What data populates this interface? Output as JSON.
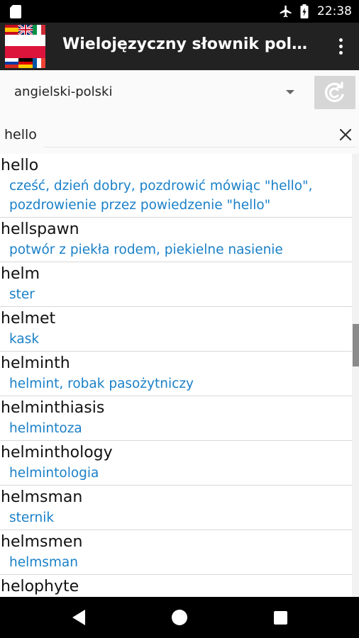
{
  "status_bar": {
    "time": "22:38",
    "icons": [
      "sim-card-icon",
      "airplane-mode-icon",
      "battery-icon"
    ]
  },
  "toolbar": {
    "title": "Wielojęzyczny słownik polski…",
    "logo_icon": "flags-logo-icon",
    "menu_icon": "overflow-menu-icon"
  },
  "language": {
    "selected": "angielski-polski",
    "swap_icon": "swap-languages-icon"
  },
  "search": {
    "value": "hello",
    "clear_icon": "close-icon"
  },
  "results": [
    {
      "word": "hello",
      "translation": "cześć, dzień dobry, pozdrowić mówiąc \"hello\", pozdrowienie przez powiedzenie \"hello\""
    },
    {
      "word": "hellspawn",
      "translation": "potwór z piekła rodem, piekielne nasienie"
    },
    {
      "word": "helm",
      "translation": "ster"
    },
    {
      "word": "helmet",
      "translation": "kask"
    },
    {
      "word": "helminth",
      "translation": "helmint, robak pasożytniczy"
    },
    {
      "word": "helminthiasis",
      "translation": "helmintoza"
    },
    {
      "word": "helminthology",
      "translation": "helmintologia"
    },
    {
      "word": "helmsman",
      "translation": "sternik"
    },
    {
      "word": "helmsmen",
      "translation": "helmsman"
    },
    {
      "word": "helophyte",
      "translation": ""
    }
  ],
  "scrollbar": {
    "position_fraction": 0.38
  },
  "colors": {
    "toolbar": "#222222",
    "translation": "#1a80c8",
    "swap_button": "#d6d6d6"
  },
  "nav_bar": {
    "icons": [
      "back-icon",
      "home-icon",
      "recents-icon"
    ]
  }
}
